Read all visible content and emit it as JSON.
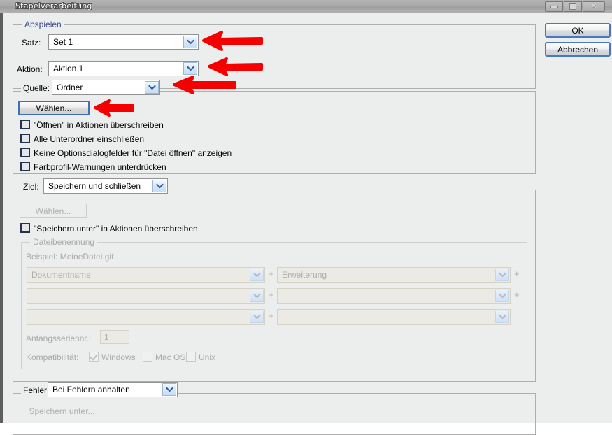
{
  "window": {
    "title": "Stapelverarbeitung",
    "controls": {
      "minimize": "minimize-icon",
      "maximize": "maximize-icon",
      "close": "✕"
    }
  },
  "actions": {
    "ok_label": "OK",
    "cancel_label": "Abbrechen"
  },
  "play_group": {
    "legend": "Abspielen",
    "set_label": "Satz:",
    "set_value": "Set 1",
    "action_label": "Aktion:",
    "action_value": "Aktion 1"
  },
  "source_group": {
    "source_label": "Quelle:",
    "source_value": "Ordner",
    "choose_button": "Wählen...",
    "checkboxes": [
      {
        "label": "\"Öffnen\" in Aktionen überschreiben",
        "checked": false
      },
      {
        "label": "Alle Unterordner einschließen",
        "checked": false
      },
      {
        "label": "Keine Optionsdialogfelder für \"Datei öffnen\" anzeigen",
        "checked": false
      },
      {
        "label": "Farbprofil-Warnungen unterdrücken",
        "checked": false
      }
    ]
  },
  "target_group": {
    "target_label": "Ziel:",
    "target_value": "Speichern und schließen",
    "choose_button": "Wählen...",
    "override_checkbox": {
      "label": "\"Speichern unter\" in Aktionen überschreiben",
      "checked": false
    },
    "naming_group": {
      "legend": "Dateibenennung",
      "example": "Beispiel: MeineDatei.gif",
      "rows": [
        {
          "left": "Dokumentname",
          "right": "Erweiterung",
          "plus_left": "+",
          "plus_right": "+"
        },
        {
          "left": "",
          "right": "",
          "plus_left": "+",
          "plus_right": "+"
        },
        {
          "left": "",
          "right": "",
          "plus_left": "+",
          "plus_right": ""
        }
      ],
      "serial_label": "Anfangsseriennr.:",
      "serial_value": "1",
      "compat_label": "Kompatibilität:",
      "compat": [
        {
          "label": "Windows",
          "checked": true
        },
        {
          "label": "Mac OS",
          "checked": false
        },
        {
          "label": "Unix",
          "checked": false
        }
      ]
    }
  },
  "error_group": {
    "error_label": "Fehler:",
    "error_value": "Bei Fehlern anhalten",
    "save_as_button": "Speichern unter..."
  },
  "annotations": {
    "arrow_color": "#f40000",
    "arrows": [
      {
        "name": "arrow-to-satz-dropdown"
      },
      {
        "name": "arrow-to-aktion-dropdown"
      },
      {
        "name": "arrow-to-quelle-dropdown"
      },
      {
        "name": "arrow-to-waehlen-button"
      }
    ]
  },
  "colors": {
    "dialog_bg": "#eceded",
    "legend_blue": "#3e4a8c",
    "focus_blue": "#4a78bd",
    "disabled_text": "#a9a9a9"
  }
}
